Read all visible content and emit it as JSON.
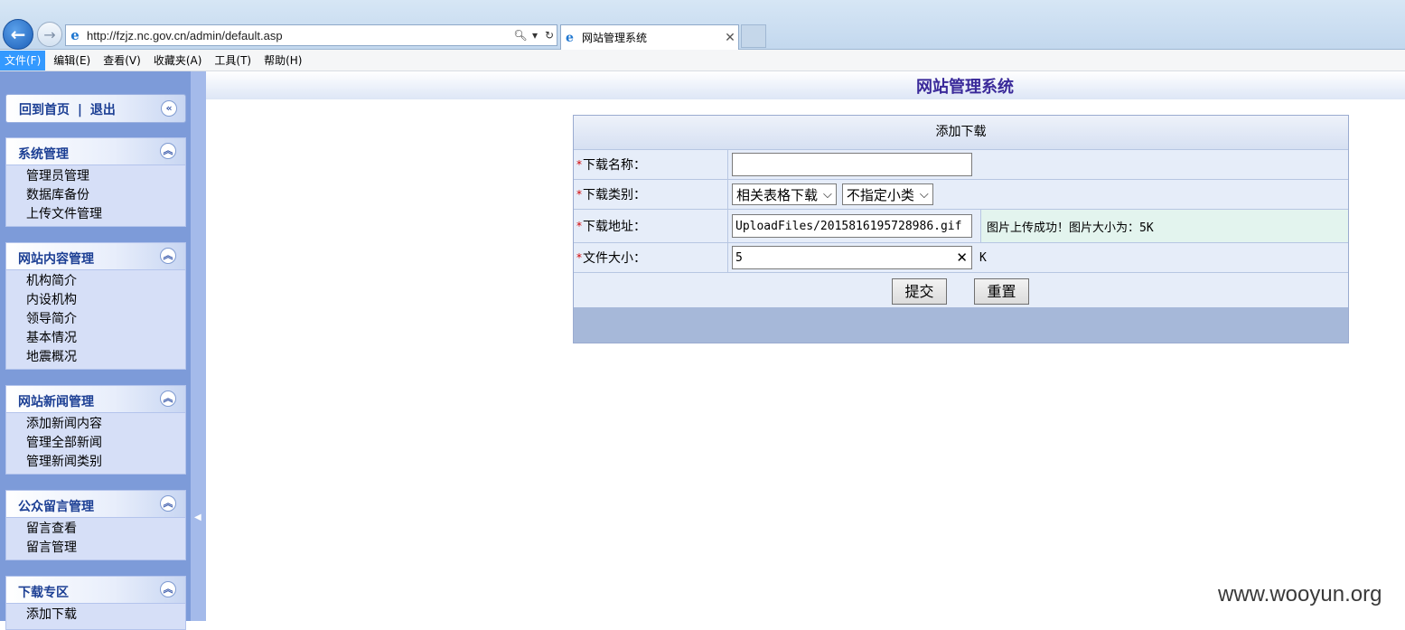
{
  "browser": {
    "url": "http://fzjz.nc.gov.cn/admin/default.asp",
    "tab_title": "网站管理系统",
    "back_icon": "arrow-left-icon",
    "forward_icon": "arrow-right-icon",
    "search_icon": "🔍︎",
    "dropdown_icon": "▾",
    "refresh_icon": "↻",
    "close_icon": "✕",
    "logo_glyph": "e"
  },
  "menu": {
    "items": [
      "文件(F)",
      "编辑(E)",
      "查看(V)",
      "收藏夹(A)",
      "工具(T)",
      "帮助(H)"
    ]
  },
  "sidebar": {
    "top_links": {
      "home": "回到首页",
      "separator": "|",
      "logout": "退出"
    },
    "collapse_glyph": "«",
    "expand_glyph": "︽",
    "splitter_arrow": "◀",
    "groups": [
      {
        "title": "系统管理",
        "items": [
          "管理员管理",
          "数据库备份",
          "上传文件管理"
        ]
      },
      {
        "title": "网站内容管理",
        "items": [
          "机构简介",
          "内设机构",
          "领导简介",
          "基本情况",
          "地震概况"
        ]
      },
      {
        "title": "网站新闻管理",
        "items": [
          "添加新闻内容",
          "管理全部新闻",
          "管理新闻类别"
        ]
      },
      {
        "title": "公众留言管理",
        "items": [
          "留言查看",
          "留言管理"
        ]
      },
      {
        "title": "下载专区",
        "items": [
          "添加下载"
        ]
      }
    ]
  },
  "main": {
    "site_title": "网站管理系统",
    "form": {
      "heading": "添加下载",
      "required_mark": "*",
      "name_label": "下载名称：",
      "name_value": "",
      "category_label": "下载类别：",
      "category_value": "相关表格下载",
      "subcategory_value": "不指定小类",
      "address_label": "下载地址：",
      "address_value": "UploadFiles/2015816195728986.gif",
      "upload_message": "图片上传成功！图片大小为：5K",
      "size_label": "文件大小：",
      "size_value": "5",
      "size_unit": "K",
      "submit_label": "提交",
      "reset_label": "重置"
    }
  },
  "watermark": "www.wooyun.org"
}
